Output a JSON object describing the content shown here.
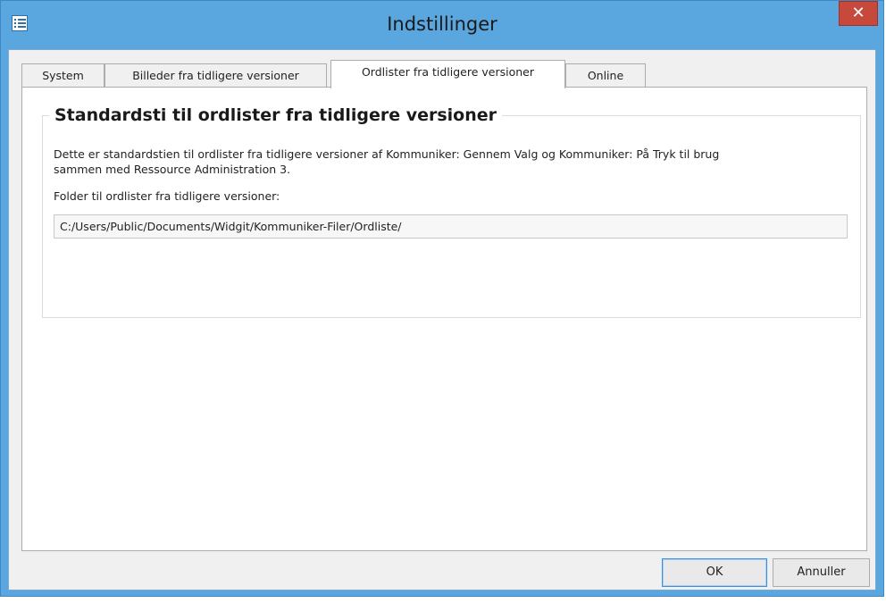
{
  "window": {
    "title": "Indstillinger",
    "app_icon": "list-settings-icon",
    "close_icon": "close-icon",
    "close_symbol": "✕"
  },
  "tabs": [
    {
      "label": "System",
      "active": false
    },
    {
      "label": "Billeder fra tidligere versioner",
      "active": false
    },
    {
      "label": "Ordlister fra tidligere versioner",
      "active": true
    },
    {
      "label": "Online",
      "active": false
    }
  ],
  "panel": {
    "group_title": "Standardsti til ordlister fra tidligere versioner",
    "description_line1": "Dette er standardstien til ordlister fra tidligere versioner af Kommuniker: Gennem Valg og Kommuniker: På Tryk til brug",
    "description_line2": "sammen med Ressource Administration 3.",
    "folder_label": "Folder til ordlister fra tidligere versioner:",
    "folder_value": "C:/Users/Public/Documents/Widgit/Kommuniker-Filer/Ordliste/"
  },
  "buttons": {
    "ok": "OK",
    "cancel": "Annuller"
  },
  "colors": {
    "titlebar": "#5aa6df",
    "close": "#c7493c",
    "client": "#f0f0f0"
  }
}
